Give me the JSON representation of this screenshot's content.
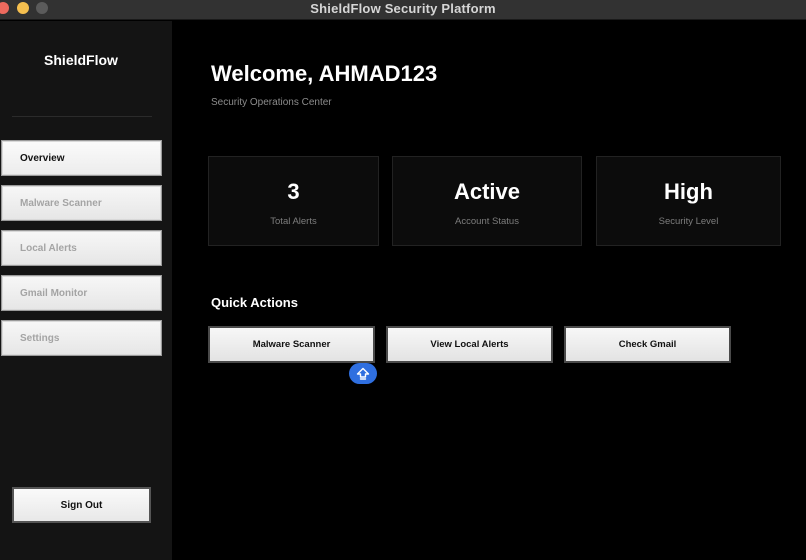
{
  "window": {
    "title": "ShieldFlow Security Platform"
  },
  "sidebar": {
    "brand": "ShieldFlow",
    "items": [
      {
        "label": "Overview",
        "active": true
      },
      {
        "label": "Malware Scanner",
        "active": false
      },
      {
        "label": "Local Alerts",
        "active": false
      },
      {
        "label": "Gmail Monitor",
        "active": false
      },
      {
        "label": "Settings",
        "active": false
      }
    ],
    "sign_out": "Sign Out"
  },
  "main": {
    "welcome": "Welcome, AHMAD123",
    "subtitle": "Security Operations Center",
    "cards": [
      {
        "value": "3",
        "label": "Total Alerts"
      },
      {
        "value": "Active",
        "label": "Account Status"
      },
      {
        "value": "High",
        "label": "Security Level"
      }
    ],
    "quick_actions": {
      "heading": "Quick Actions",
      "buttons": [
        "Malware Scanner",
        "View Local Alerts",
        "Check Gmail"
      ]
    }
  },
  "icons": {
    "float_button": "upload-arrow-icon"
  },
  "colors": {
    "accent": "#2f6fe0",
    "background": "#000000",
    "sidebar": "#141414"
  }
}
